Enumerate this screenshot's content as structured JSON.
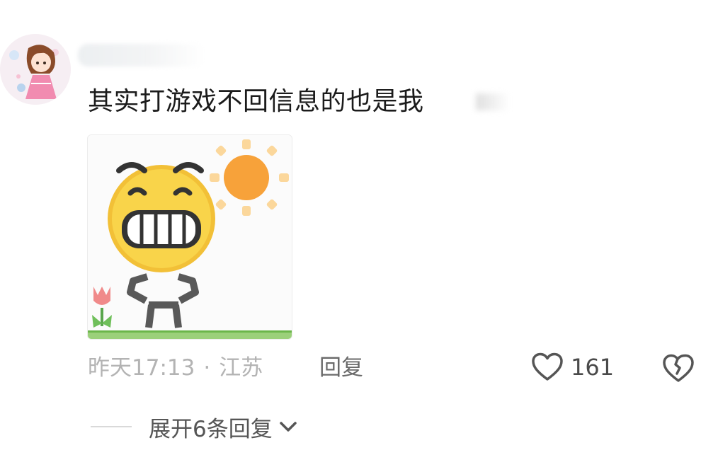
{
  "comment": {
    "text": "其实打游戏不回信息的也是我",
    "timestamp": "昨天17:13",
    "separator": "·",
    "location": "江苏",
    "reply_label": "回复",
    "like_count": "161"
  },
  "replies": {
    "expand_label": "展开6条回复"
  },
  "icons": {
    "like": "heart-outline-icon",
    "dislike": "broken-heart-icon",
    "expand": "chevron-down-icon"
  },
  "colors": {
    "text_primary": "#1b1b1b",
    "text_meta": "#b3b3b3",
    "icon_gray": "#555555"
  }
}
